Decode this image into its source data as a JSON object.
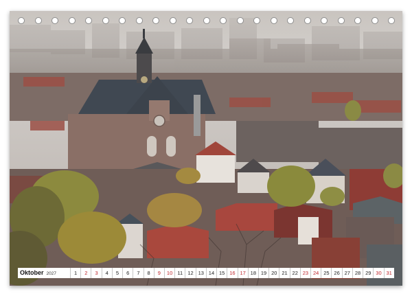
{
  "calendar": {
    "month_name": "Oktober",
    "year": "2027",
    "days": [
      {
        "n": "1",
        "w": false
      },
      {
        "n": "2",
        "w": true
      },
      {
        "n": "3",
        "w": true
      },
      {
        "n": "4",
        "w": false
      },
      {
        "n": "5",
        "w": false
      },
      {
        "n": "6",
        "w": false
      },
      {
        "n": "7",
        "w": false
      },
      {
        "n": "8",
        "w": false
      },
      {
        "n": "9",
        "w": true
      },
      {
        "n": "10",
        "w": true
      },
      {
        "n": "11",
        "w": false
      },
      {
        "n": "12",
        "w": false
      },
      {
        "n": "13",
        "w": false
      },
      {
        "n": "14",
        "w": false
      },
      {
        "n": "15",
        "w": false
      },
      {
        "n": "16",
        "w": true
      },
      {
        "n": "17",
        "w": true
      },
      {
        "n": "18",
        "w": false
      },
      {
        "n": "19",
        "w": false
      },
      {
        "n": "20",
        "w": false
      },
      {
        "n": "21",
        "w": false
      },
      {
        "n": "22",
        "w": false
      },
      {
        "n": "23",
        "w": true
      },
      {
        "n": "24",
        "w": true
      },
      {
        "n": "25",
        "w": false
      },
      {
        "n": "26",
        "w": false
      },
      {
        "n": "27",
        "w": false
      },
      {
        "n": "28",
        "w": false
      },
      {
        "n": "29",
        "w": false
      },
      {
        "n": "30",
        "w": true
      },
      {
        "n": "31",
        "w": true
      }
    ],
    "weekend_color": "#c0262c",
    "ring_count": 23
  },
  "photo": {
    "subject": "Amsterdam city panorama with church tower and gabled rooftops"
  }
}
